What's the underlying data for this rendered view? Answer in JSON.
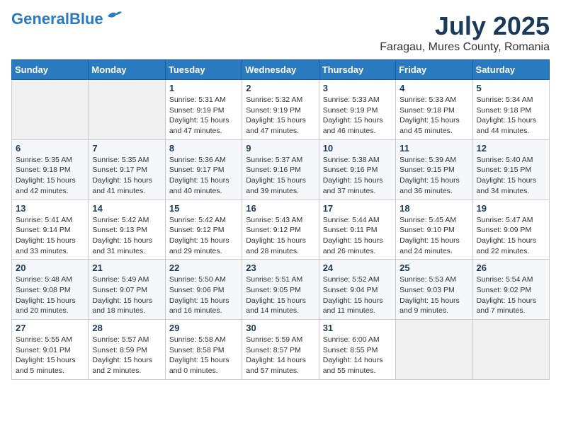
{
  "header": {
    "logo_line1": "General",
    "logo_line2": "Blue",
    "month_title": "July 2025",
    "location": "Faragau, Mures County, Romania"
  },
  "weekdays": [
    "Sunday",
    "Monday",
    "Tuesday",
    "Wednesday",
    "Thursday",
    "Friday",
    "Saturday"
  ],
  "weeks": [
    [
      {
        "day": "",
        "empty": true
      },
      {
        "day": "",
        "empty": true
      },
      {
        "day": "1",
        "sunrise": "5:31 AM",
        "sunset": "9:19 PM",
        "daylight": "15 hours and 47 minutes."
      },
      {
        "day": "2",
        "sunrise": "5:32 AM",
        "sunset": "9:19 PM",
        "daylight": "15 hours and 47 minutes."
      },
      {
        "day": "3",
        "sunrise": "5:33 AM",
        "sunset": "9:19 PM",
        "daylight": "15 hours and 46 minutes."
      },
      {
        "day": "4",
        "sunrise": "5:33 AM",
        "sunset": "9:18 PM",
        "daylight": "15 hours and 45 minutes."
      },
      {
        "day": "5",
        "sunrise": "5:34 AM",
        "sunset": "9:18 PM",
        "daylight": "15 hours and 44 minutes."
      }
    ],
    [
      {
        "day": "6",
        "sunrise": "5:35 AM",
        "sunset": "9:18 PM",
        "daylight": "15 hours and 42 minutes."
      },
      {
        "day": "7",
        "sunrise": "5:35 AM",
        "sunset": "9:17 PM",
        "daylight": "15 hours and 41 minutes."
      },
      {
        "day": "8",
        "sunrise": "5:36 AM",
        "sunset": "9:17 PM",
        "daylight": "15 hours and 40 minutes."
      },
      {
        "day": "9",
        "sunrise": "5:37 AM",
        "sunset": "9:16 PM",
        "daylight": "15 hours and 39 minutes."
      },
      {
        "day": "10",
        "sunrise": "5:38 AM",
        "sunset": "9:16 PM",
        "daylight": "15 hours and 37 minutes."
      },
      {
        "day": "11",
        "sunrise": "5:39 AM",
        "sunset": "9:15 PM",
        "daylight": "15 hours and 36 minutes."
      },
      {
        "day": "12",
        "sunrise": "5:40 AM",
        "sunset": "9:15 PM",
        "daylight": "15 hours and 34 minutes."
      }
    ],
    [
      {
        "day": "13",
        "sunrise": "5:41 AM",
        "sunset": "9:14 PM",
        "daylight": "15 hours and 33 minutes."
      },
      {
        "day": "14",
        "sunrise": "5:42 AM",
        "sunset": "9:13 PM",
        "daylight": "15 hours and 31 minutes."
      },
      {
        "day": "15",
        "sunrise": "5:42 AM",
        "sunset": "9:12 PM",
        "daylight": "15 hours and 29 minutes."
      },
      {
        "day": "16",
        "sunrise": "5:43 AM",
        "sunset": "9:12 PM",
        "daylight": "15 hours and 28 minutes."
      },
      {
        "day": "17",
        "sunrise": "5:44 AM",
        "sunset": "9:11 PM",
        "daylight": "15 hours and 26 minutes."
      },
      {
        "day": "18",
        "sunrise": "5:45 AM",
        "sunset": "9:10 PM",
        "daylight": "15 hours and 24 minutes."
      },
      {
        "day": "19",
        "sunrise": "5:47 AM",
        "sunset": "9:09 PM",
        "daylight": "15 hours and 22 minutes."
      }
    ],
    [
      {
        "day": "20",
        "sunrise": "5:48 AM",
        "sunset": "9:08 PM",
        "daylight": "15 hours and 20 minutes."
      },
      {
        "day": "21",
        "sunrise": "5:49 AM",
        "sunset": "9:07 PM",
        "daylight": "15 hours and 18 minutes."
      },
      {
        "day": "22",
        "sunrise": "5:50 AM",
        "sunset": "9:06 PM",
        "daylight": "15 hours and 16 minutes."
      },
      {
        "day": "23",
        "sunrise": "5:51 AM",
        "sunset": "9:05 PM",
        "daylight": "15 hours and 14 minutes."
      },
      {
        "day": "24",
        "sunrise": "5:52 AM",
        "sunset": "9:04 PM",
        "daylight": "15 hours and 11 minutes."
      },
      {
        "day": "25",
        "sunrise": "5:53 AM",
        "sunset": "9:03 PM",
        "daylight": "15 hours and 9 minutes."
      },
      {
        "day": "26",
        "sunrise": "5:54 AM",
        "sunset": "9:02 PM",
        "daylight": "15 hours and 7 minutes."
      }
    ],
    [
      {
        "day": "27",
        "sunrise": "5:55 AM",
        "sunset": "9:01 PM",
        "daylight": "15 hours and 5 minutes."
      },
      {
        "day": "28",
        "sunrise": "5:57 AM",
        "sunset": "8:59 PM",
        "daylight": "15 hours and 2 minutes."
      },
      {
        "day": "29",
        "sunrise": "5:58 AM",
        "sunset": "8:58 PM",
        "daylight": "15 hours and 0 minutes."
      },
      {
        "day": "30",
        "sunrise": "5:59 AM",
        "sunset": "8:57 PM",
        "daylight": "14 hours and 57 minutes."
      },
      {
        "day": "31",
        "sunrise": "6:00 AM",
        "sunset": "8:55 PM",
        "daylight": "14 hours and 55 minutes."
      },
      {
        "day": "",
        "empty": true
      },
      {
        "day": "",
        "empty": true
      }
    ]
  ]
}
